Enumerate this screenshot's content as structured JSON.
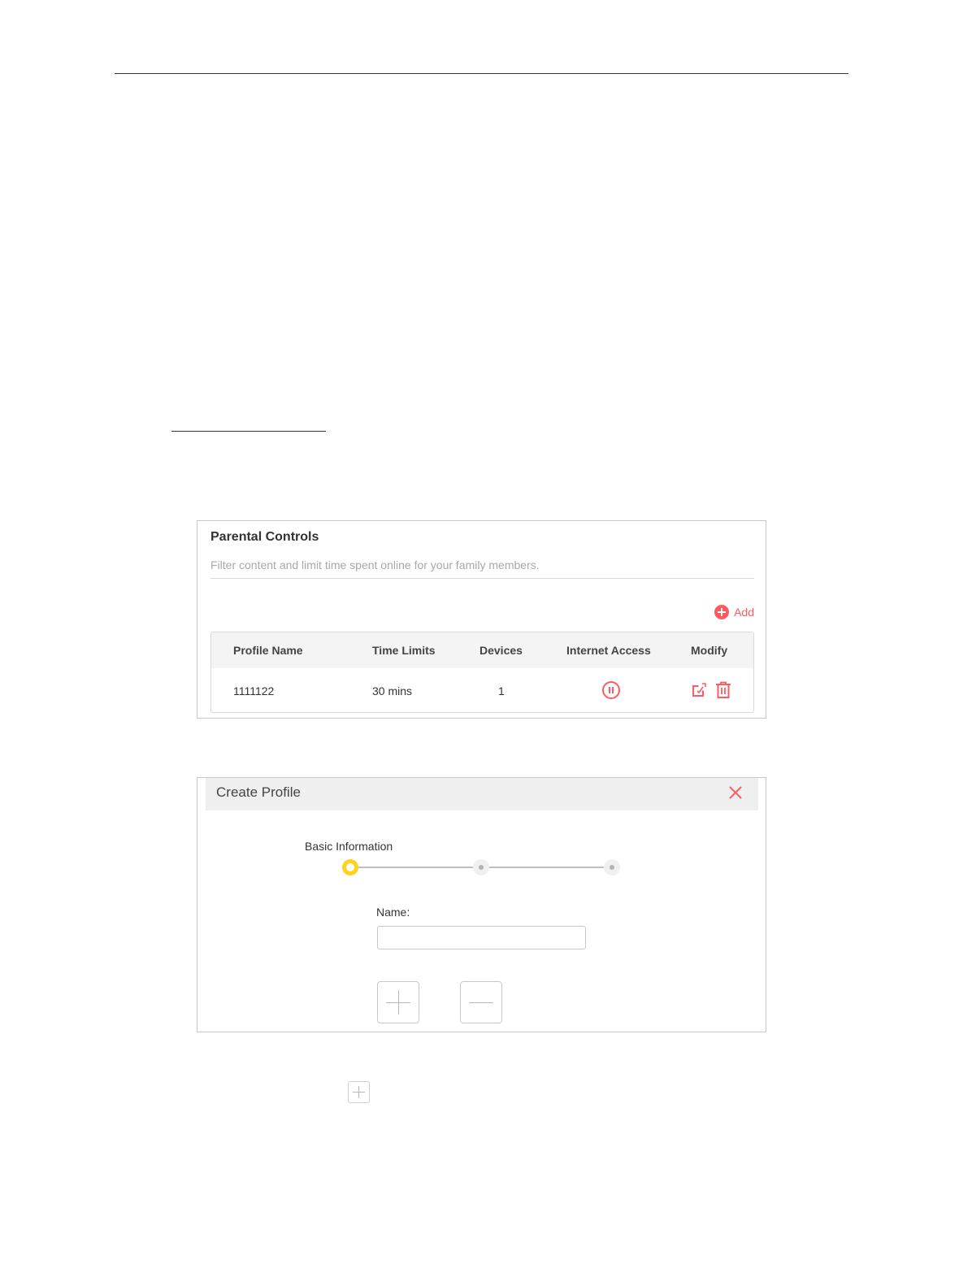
{
  "parental_controls": {
    "title": "Parental Controls",
    "subtitle": "Filter content and limit time spent online for your family members.",
    "add_label": "Add",
    "columns": [
      "Profile Name",
      "Time Limits",
      "Devices",
      "Internet Access",
      "Modify"
    ],
    "rows": [
      {
        "profile_name": "1111122",
        "time_limits": "30 mins",
        "devices": "1",
        "internet_access_icon": "pause-icon",
        "modify_icons": [
          "edit-icon",
          "delete-icon"
        ]
      }
    ]
  },
  "create_profile": {
    "title": "Create Profile",
    "close_icon": "close-icon",
    "steps": [
      {
        "label": "Basic Information",
        "state": "active"
      },
      {
        "label": "",
        "state": "pending"
      },
      {
        "label": "",
        "state": "pending"
      }
    ],
    "name_label": "Name:",
    "name_value": "",
    "buttons": [
      "plus-icon",
      "minus-icon"
    ]
  },
  "inline_icon": "plus-icon",
  "colors": {
    "accent_red": "#ff5a5f",
    "step_active": "#ffd21e",
    "header_bg": "#f4f4f4"
  }
}
